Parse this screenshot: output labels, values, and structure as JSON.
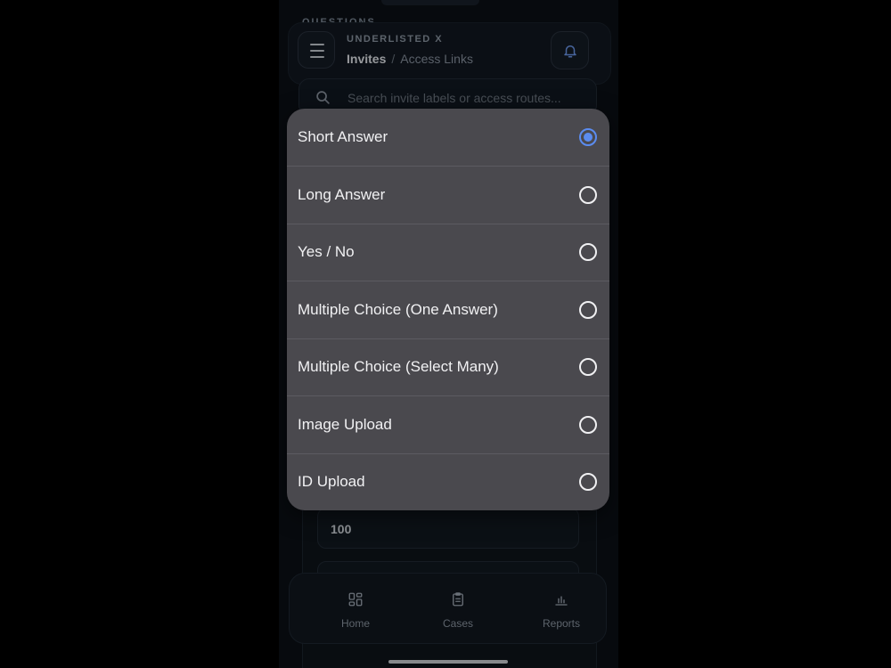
{
  "background_section": {
    "label": "QUESTIONS"
  },
  "header": {
    "app_name": "UNDERLISTED X",
    "breadcrumb_current": "Invites",
    "breadcrumb_separator": "/",
    "breadcrumb_child": "Access Links"
  },
  "search": {
    "placeholder": "Search invite labels or access routes..."
  },
  "form": {
    "value": "100"
  },
  "tabbar": {
    "items": [
      {
        "label": "Home",
        "icon": "grid-icon"
      },
      {
        "label": "Cases",
        "icon": "clipboard-icon"
      },
      {
        "label": "Reports",
        "icon": "bar-chart-icon"
      }
    ]
  },
  "picker": {
    "selected_index": 0,
    "options": [
      {
        "label": "Short Answer"
      },
      {
        "label": "Long Answer"
      },
      {
        "label": "Yes / No"
      },
      {
        "label": "Multiple Choice (One Answer)"
      },
      {
        "label": "Multiple Choice (Select Many)"
      },
      {
        "label": "Image Upload"
      },
      {
        "label": "ID Upload"
      }
    ]
  },
  "colors": {
    "accent": "#5b8cf0",
    "sheet_bg": "#4a494e",
    "app_bg": "#0b1016"
  }
}
